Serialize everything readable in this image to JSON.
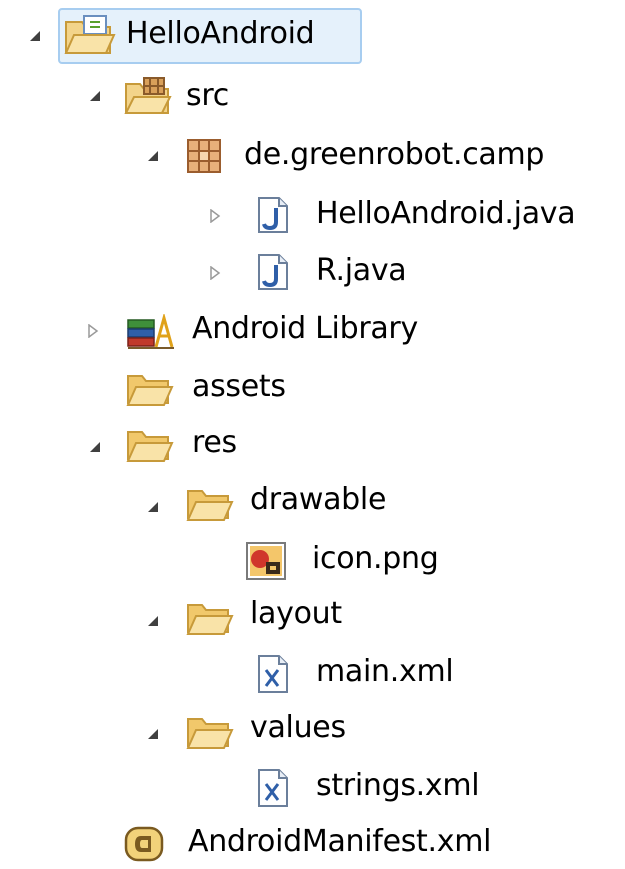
{
  "tree": {
    "nodes": [
      {
        "label": "HelloAndroid",
        "icon": "android-project-icon",
        "expanded": true,
        "selected": true
      },
      {
        "label": "src",
        "icon": "source-folder-icon",
        "expanded": true
      },
      {
        "label": "de.greenrobot.camp",
        "icon": "package-icon",
        "expanded": true
      },
      {
        "label": "HelloAndroid.java",
        "icon": "java-file-icon",
        "expanded": false
      },
      {
        "label": "R.java",
        "icon": "java-file-icon",
        "expanded": false
      },
      {
        "label": "Android Library",
        "icon": "library-icon",
        "expanded": false
      },
      {
        "label": "assets",
        "icon": "folder-icon"
      },
      {
        "label": "res",
        "icon": "folder-icon",
        "expanded": true
      },
      {
        "label": "drawable",
        "icon": "folder-icon",
        "expanded": true
      },
      {
        "label": "icon.png",
        "icon": "image-file-icon"
      },
      {
        "label": "layout",
        "icon": "folder-icon",
        "expanded": true
      },
      {
        "label": "main.xml",
        "icon": "xml-file-icon"
      },
      {
        "label": "values",
        "icon": "folder-icon",
        "expanded": true
      },
      {
        "label": "strings.xml",
        "icon": "xml-file-icon"
      },
      {
        "label": "AndroidManifest.xml",
        "icon": "android-manifest-icon"
      }
    ]
  },
  "colors": {
    "selection_border": "#a7cdf0",
    "selection_fill": "#e5f1fb",
    "folder": "#f1c86b",
    "folder_border": "#c79a3a"
  }
}
